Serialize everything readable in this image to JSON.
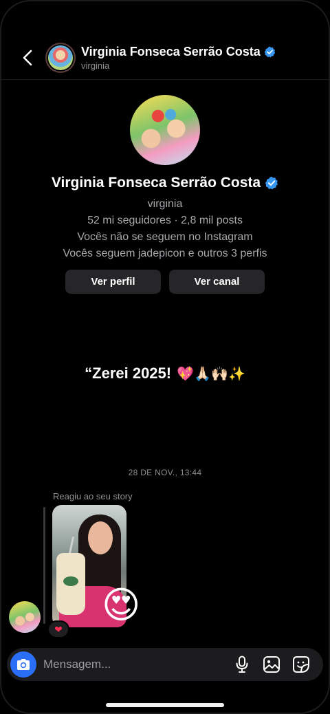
{
  "header": {
    "name": "Virginia Fonseca Serrão Costa",
    "username": "virginia"
  },
  "profile": {
    "name": "Virginia Fonseca Serrão Costa",
    "username": "virginia",
    "stats": "52 mi seguidores · 2,8 mil posts",
    "follow_status": "Vocês não se seguem no Instagram",
    "mutuals": "Vocês seguem jadepicon e outros 3 perfis",
    "view_profile_label": "Ver perfil",
    "view_channel_label": "Ver canal"
  },
  "story_caption": {
    "text": "“Zerei 2025!",
    "emojis": "💖🙏🏻🙌🏻✨"
  },
  "thread": {
    "timestamp": "28 DE NOV., 13:44",
    "reacted_label": "Reagiu ao seu story",
    "story_reaction_emoji": "😍",
    "message_reaction": "❤"
  },
  "composer": {
    "placeholder": "Mensagem..."
  },
  "colors": {
    "background": "#000000",
    "verified": "#3797f0",
    "camera_button": "#2a6ef5",
    "button_bg": "#262628"
  },
  "icons": [
    "back-chevron-icon",
    "verified-badge-icon",
    "camera-icon",
    "microphone-icon",
    "gallery-icon",
    "sticker-icon"
  ]
}
